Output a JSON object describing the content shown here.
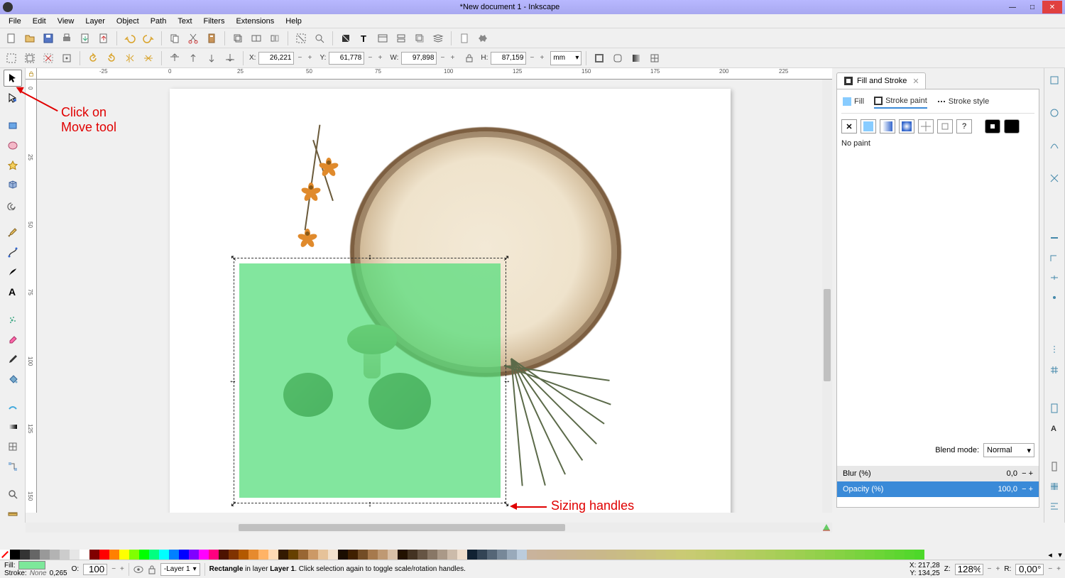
{
  "window": {
    "title": "*New document 1 - Inkscape",
    "min": "—",
    "max": "□",
    "close": "✕"
  },
  "menu": [
    "File",
    "Edit",
    "View",
    "Layer",
    "Object",
    "Path",
    "Text",
    "Filters",
    "Extensions",
    "Help"
  ],
  "coords": {
    "x_label": "X:",
    "x": "26,221",
    "y_label": "Y:",
    "y": "61,778",
    "w_label": "W:",
    "w": "97,898",
    "h_label": "H:",
    "h": "87,159",
    "unit": "mm"
  },
  "ruler_h": [
    "-25",
    "0",
    "25",
    "50",
    "75",
    "100",
    "125",
    "150",
    "175",
    "200",
    "225"
  ],
  "ruler_v": [
    "0",
    "25",
    "50",
    "75",
    "100",
    "125",
    "150"
  ],
  "panel": {
    "title": "Fill and Stroke",
    "tabs": {
      "fill": "Fill",
      "stroke_paint": "Stroke paint",
      "stroke_style": "Stroke style"
    },
    "nopaint": "No paint",
    "blend_label": "Blend mode:",
    "blend_value": "Normal",
    "blur_label": "Blur (%)",
    "blur_value": "0,0",
    "opacity_label": "Opacity (%)",
    "opacity_value": "100,0",
    "qmark": "?"
  },
  "annotations": {
    "move_tool_line1": "Click on",
    "move_tool_line2": "Move tool",
    "sizing": "Sizing handles"
  },
  "statusbar": {
    "fill_label": "Fill:",
    "stroke_label": "Stroke:",
    "stroke_value": "None",
    "stroke_num": "0,265",
    "o_label": "O:",
    "o_value": "100",
    "layer": "-Layer 1",
    "msg_prefix": "Rectangle",
    "msg_mid": " in layer ",
    "msg_layer": "Layer 1",
    "msg_suffix": ". Click selection again to toggle scale/rotation handles.",
    "xc_label": "X:",
    "xc": "217,28",
    "yc_label": "Y:",
    "yc": "134,25",
    "z_label": "Z:",
    "z": "128%",
    "r_label": "R:",
    "r": "0,00°"
  },
  "palette_colors": [
    "#000",
    "#333",
    "#666",
    "#999",
    "#b3b3b3",
    "#ccc",
    "#e6e6e6",
    "#fff",
    "#800000",
    "#f00",
    "#ff8000",
    "#ff0",
    "#80ff00",
    "#0f0",
    "#00ff80",
    "#0ff",
    "#0080ff",
    "#00f",
    "#8000ff",
    "#f0f",
    "#ff0080",
    "#4d1300",
    "#803300",
    "#b35900",
    "#e68a2e",
    "#ffb366",
    "#ffd9b3",
    "#331a00",
    "#664000",
    "#996633",
    "#cc9966",
    "#e6c299",
    "#f2e0cc",
    "#1a0d00",
    "#402000",
    "#734d26",
    "#a6794d",
    "#bf9973",
    "#d9bfa6",
    "#210",
    "#432",
    "#654",
    "#876",
    "#a98",
    "#cba",
    "#edc",
    "#123",
    "#345",
    "#567",
    "#789",
    "#9ab",
    "#bcd"
  ]
}
